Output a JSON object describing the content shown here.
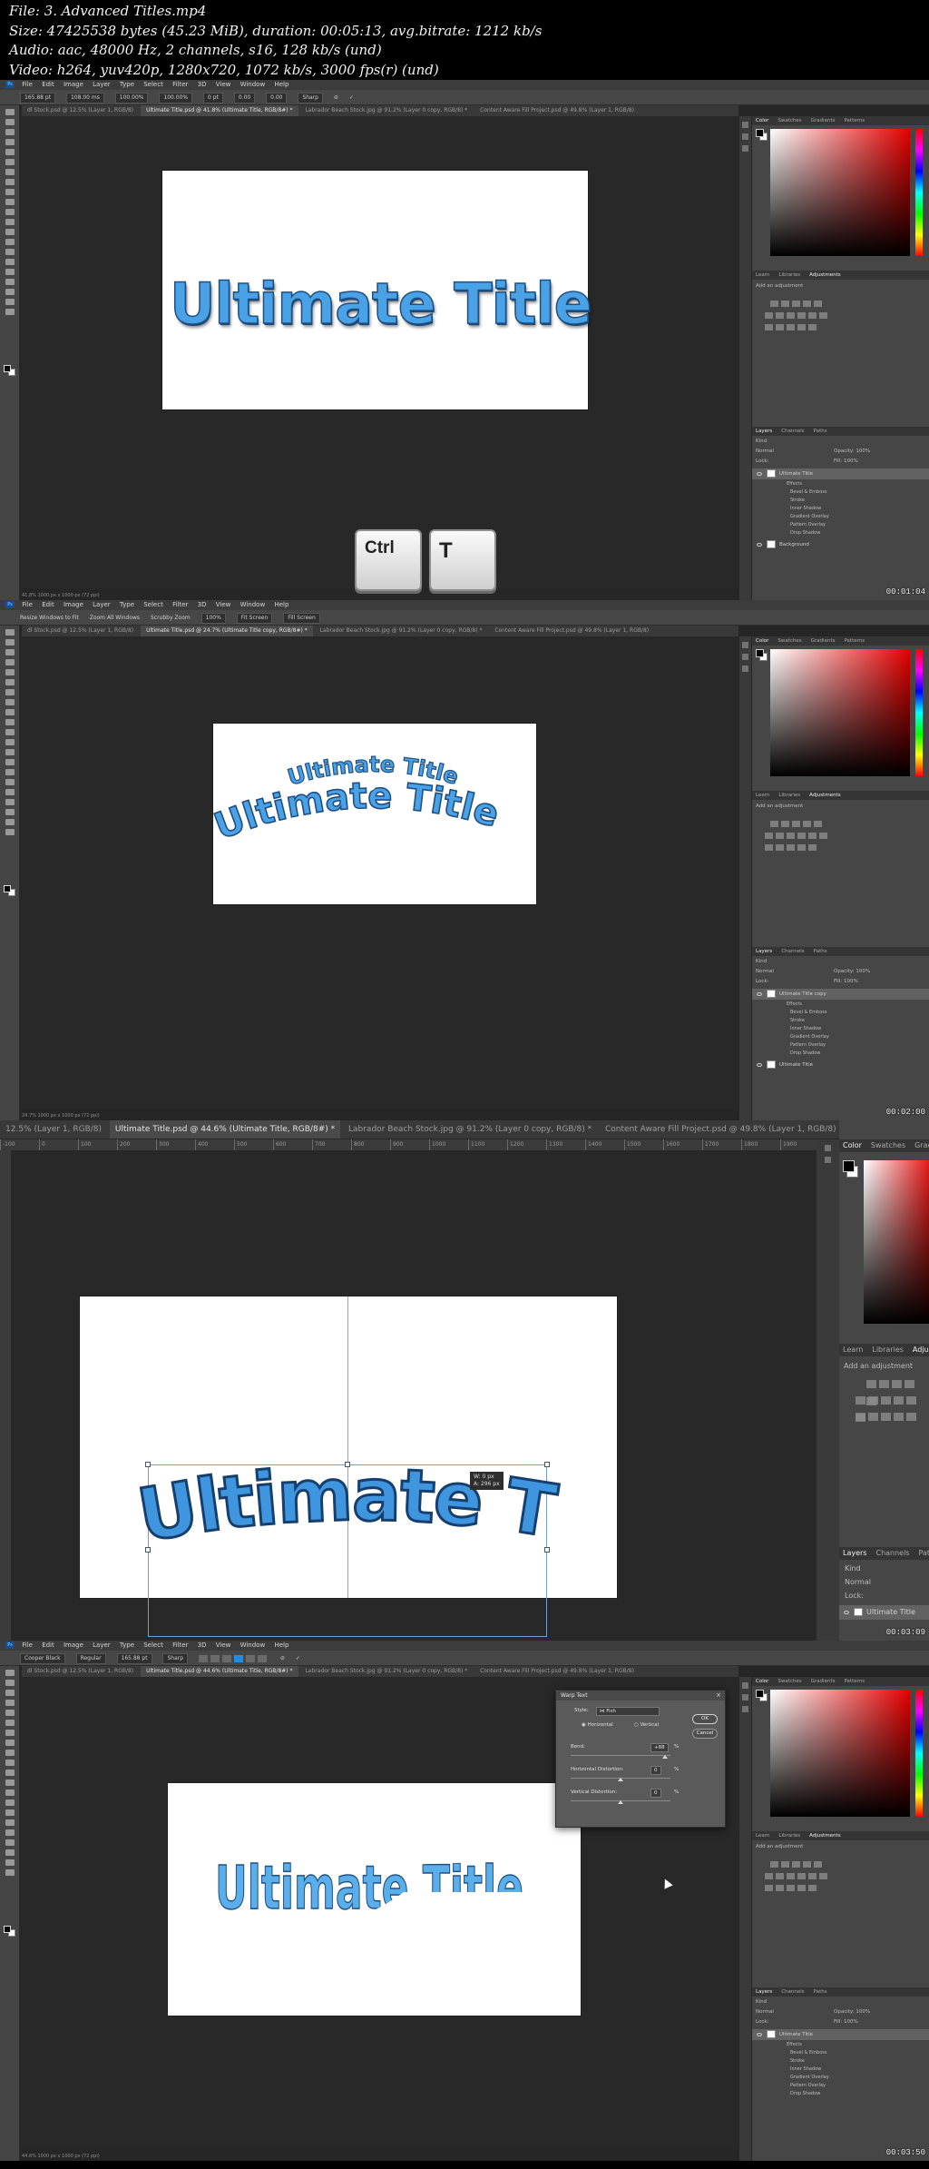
{
  "video_info": {
    "file": "File: 3. Advanced Titles.mp4",
    "size": "Size: 47425538 bytes (45.23 MiB), duration: 00:05:13, avg.bitrate: 1212 kb/s",
    "audio": "Audio: aac, 48000 Hz, 2 channels, s16, 128 kb/s (und)",
    "video": "Video: h264, yuv420p, 1280x720, 1072 kb/s, 3000 fps(r) (und)"
  },
  "menu": {
    "app_icon": "Ps",
    "items": [
      "File",
      "Edit",
      "Image",
      "Layer",
      "Type",
      "Select",
      "Filter",
      "3D",
      "View",
      "Window",
      "Help"
    ]
  },
  "frames": [
    {
      "timestamp": "00:01:04",
      "tabs": [
        "dl Stock.psd @ 12.5% (Layer 1, RGB/8)",
        "Ultimate Title.psd @ 41.8% (Ultimate Title, RGB/8#) *",
        "Labrador Beach Stock.jpg @ 91.2% (Layer 0 copy, RGB/8) *",
        "Content Aware Fill Project.psd @ 49.8% (Layer 1, RGB/8)"
      ],
      "options": [
        "165.88 pt",
        "108.00 ms",
        "100.00%",
        "100.00%",
        "0 pt",
        "0.00",
        "0.00",
        "Sharp"
      ],
      "status": "41.8%    1000 px x 1000 px (72 ppi)",
      "title_text": "Ultimate Title",
      "keys": [
        "Ctrl",
        "T"
      ],
      "layer_name": "Ultimate Title",
      "effects": [
        "Effects",
        "Bevel & Emboss",
        "Stroke",
        "Inner Shadow",
        "Gradient Overlay",
        "Pattern Overlay",
        "Drop Shadow"
      ],
      "background_layer": "Background"
    },
    {
      "timestamp": "00:02:00",
      "tabs": [
        "dl Stock.psd @ 12.5% (Layer 1, RGB/8)",
        "Ultimate Title.psd @ 24.7% (Ultimate Title copy, RGB/8#) *",
        "Labrador Beach Stock.jpg @ 91.2% (Layer 0 copy, RGB/8) *",
        "Content Aware Fill Project.psd @ 49.8% (Layer 1, RGB/8)"
      ],
      "options": [
        "Resize Windows to Fit",
        "Zoom All Windows",
        "Scrubby Zoom",
        "100%",
        "Fit Screen",
        "Fill Screen"
      ],
      "status": "24.7%    1000 px x 1000 px (72 ppi)",
      "title_small": "Ultimate Title",
      "title_text": "Ultimate Title",
      "layer_name": "Ultimate Title copy",
      "effects": [
        "Effects",
        "Bevel & Emboss",
        "Stroke",
        "Inner Shadow",
        "Gradient Overlay",
        "Pattern Overlay",
        "Drop Shadow"
      ],
      "bottom_layer": "Ultimate Title"
    },
    {
      "timestamp": "00:03:09",
      "tabs": [
        "12.5% (Layer 1, RGB/8)",
        "Ultimate Title.psd @ 44.6% (Ultimate Title, RGB/8#) *",
        "Labrador Beach Stock.jpg @ 91.2% (Layer 0 copy, RGB/8) *",
        "Content Aware Fill Project.psd @ 49.8% (Layer 1, RGB/8)"
      ],
      "ruler": [
        "-100",
        "0",
        "100",
        "200",
        "300",
        "400",
        "500",
        "600",
        "700",
        "800",
        "900",
        "1000",
        "1100",
        "1200",
        "1300",
        "1400",
        "1500",
        "1600",
        "1700",
        "1800",
        "1900"
      ],
      "transform_readout": [
        "W: 0 px",
        "A: 296 px"
      ],
      "title_text": "Ultimate Title",
      "panel_tabs": [
        "Color",
        "Swatches",
        "Gradie"
      ],
      "adj_tabs": [
        "Learn",
        "Libraries",
        "Adjustm"
      ],
      "add_adjustment": "Add an adjustment",
      "layers_tabs": [
        "Layers",
        "Channels",
        "Paths"
      ],
      "kind": "Kind",
      "blend": "Normal",
      "lock": "Lock:",
      "layer_name": "Ultimate Title"
    },
    {
      "timestamp": "00:03:50",
      "tabs": [
        "dl Stock.psd @ 12.5% (Layer 1, RGB/8)",
        "Ultimate Title.psd @ 44.6% (Ultimate Title, RGB/8#) *",
        "Labrador Beach Stock.jpg @ 91.2% (Layer 0 copy, RGB/8) *",
        "Content Aware Fill Project.psd @ 49.8% (Layer 1, RGB/8)"
      ],
      "options": [
        "Cooper Black",
        "Regular",
        "165.88 pt",
        "Sharp"
      ],
      "status": "44.6%    1000 px x 1000 px (72 ppi)",
      "title_text": "Ultimate Title",
      "dialog": {
        "title": "Warp Text",
        "style_label": "Style:",
        "style_value": "Fish",
        "horizontal": "Horizontal",
        "vertical": "Vertical",
        "bend_label": "Bend:",
        "bend_value": "+88",
        "hdist_label": "Horizontal Distortion:",
        "hdist_value": "0",
        "vdist_label": "Vertical Distortion:",
        "vdist_value": "0",
        "pct": "%",
        "ok": "OK",
        "cancel": "Cancel"
      },
      "layer_name": "Ultimate Title",
      "effects": [
        "Effects",
        "Bevel & Emboss",
        "Stroke",
        "Inner Shadow",
        "Gradient Overlay",
        "Pattern Overlay",
        "Drop Shadow"
      ]
    }
  ],
  "panels": {
    "color_tabs": [
      "Color",
      "Swatches",
      "Gradients",
      "Patterns"
    ],
    "adj_tabs": [
      "Learn",
      "Libraries",
      "Adjustments"
    ],
    "add_adjustment": "Add an adjustment",
    "layers_tabs": [
      "Layers",
      "Channels",
      "Paths"
    ],
    "kind": "Kind",
    "blend": "Normal",
    "opacity": "Opacity: 100%",
    "lock": "Lock:",
    "fill": "Fill: 100%"
  }
}
